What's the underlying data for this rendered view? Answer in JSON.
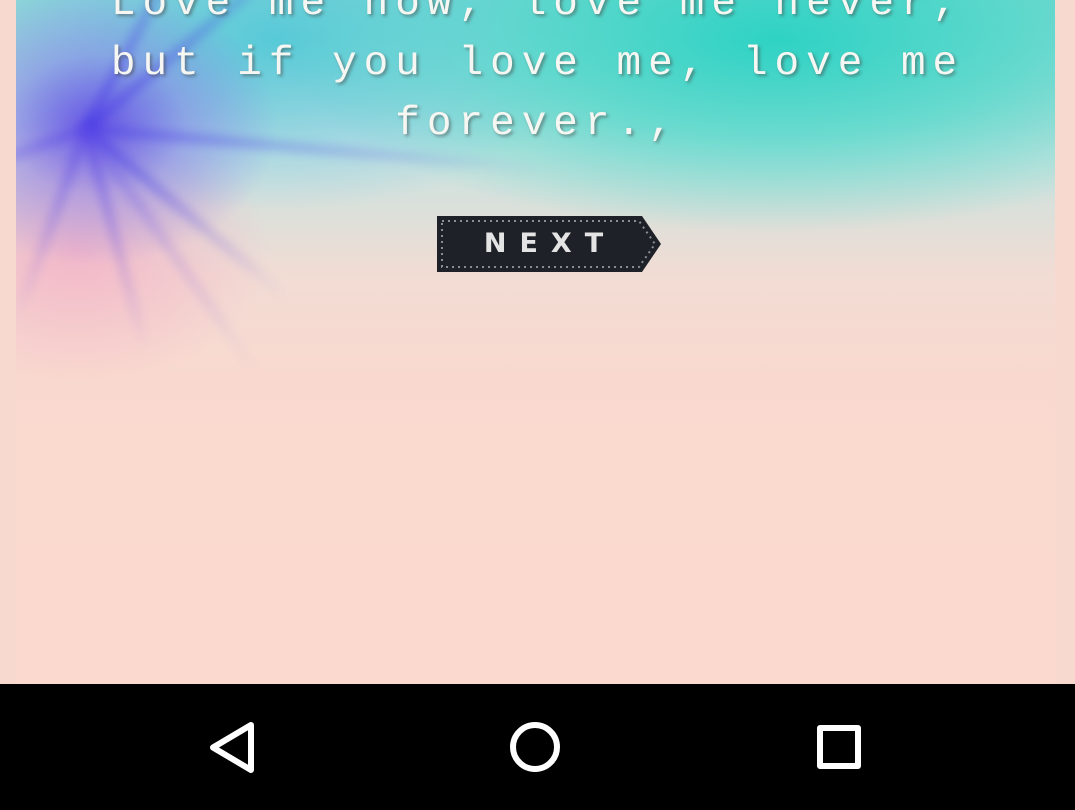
{
  "quote": {
    "line1": "Love me now, love me never,",
    "line2": "but if you love me, love me",
    "line3": "forever.,"
  },
  "next_button": {
    "label": "NEXT",
    "icon": "next-arrow-tag"
  },
  "navigation_bar": {
    "back": {
      "icon": "back-triangle-icon"
    },
    "home": {
      "icon": "home-circle-icon"
    },
    "recents": {
      "icon": "recents-square-icon"
    }
  },
  "colors": {
    "background": "#f8d9cf",
    "navbar": "#000000",
    "tag": "#1e2228",
    "quote_text": "#f6f6f2"
  }
}
